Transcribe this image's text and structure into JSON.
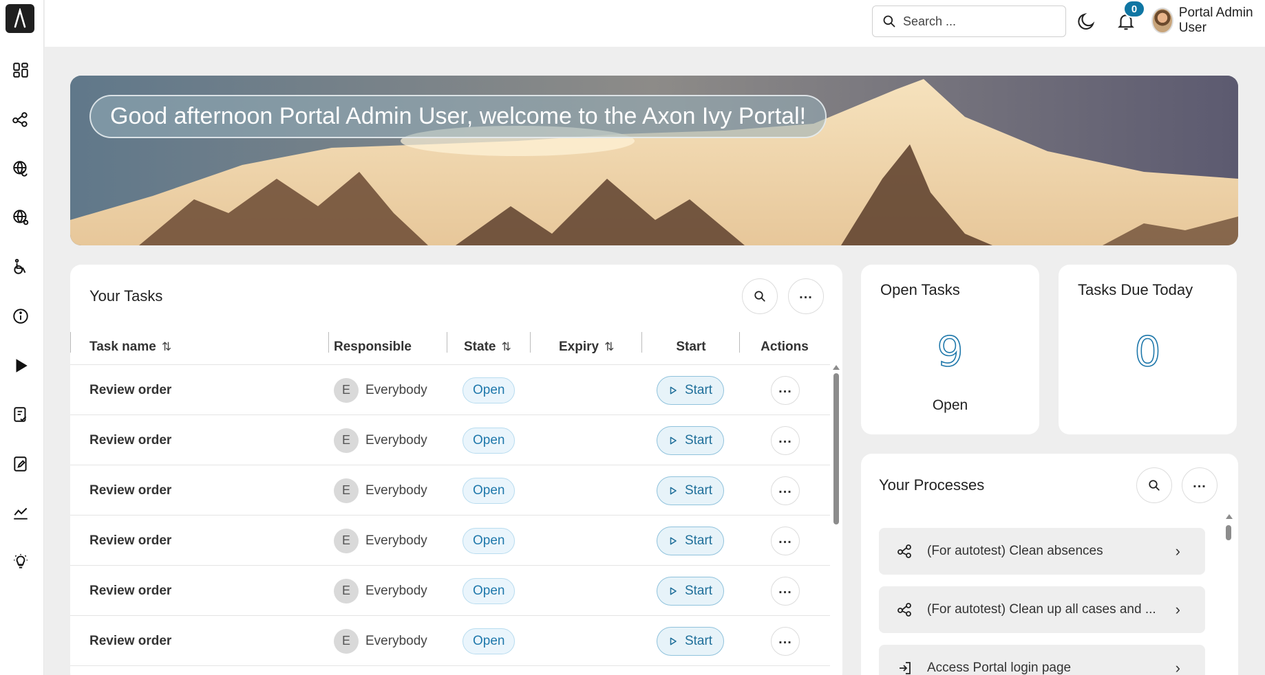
{
  "topbar": {
    "search_placeholder": "Search ...",
    "notification_count": "0",
    "user_name": "Portal Admin User"
  },
  "sidebar": {
    "items": [
      {
        "icon": "dashboard-icon"
      },
      {
        "icon": "process-icon"
      },
      {
        "icon": "globe-refresh-icon"
      },
      {
        "icon": "globe-network-icon"
      },
      {
        "icon": "wheelchair-icon"
      },
      {
        "icon": "info-icon"
      },
      {
        "icon": "play-icon"
      },
      {
        "icon": "task-list-icon"
      },
      {
        "icon": "document-edit-icon"
      },
      {
        "icon": "statistics-icon"
      },
      {
        "icon": "lightbulb-icon"
      }
    ]
  },
  "banner": {
    "greeting": "Good afternoon Portal Admin User, welcome to the Axon Ivy Portal!"
  },
  "tasks": {
    "title": "Your Tasks",
    "columns": [
      "Task name",
      "Responsible",
      "State",
      "Expiry",
      "Start",
      "Actions"
    ],
    "rows": [
      {
        "name": "Review order",
        "responsible_initial": "E",
        "responsible": "Everybody",
        "state": "Open",
        "start": "Start"
      },
      {
        "name": "Review order",
        "responsible_initial": "E",
        "responsible": "Everybody",
        "state": "Open",
        "start": "Start"
      },
      {
        "name": "Review order",
        "responsible_initial": "E",
        "responsible": "Everybody",
        "state": "Open",
        "start": "Start"
      },
      {
        "name": "Review order",
        "responsible_initial": "E",
        "responsible": "Everybody",
        "state": "Open",
        "start": "Start"
      },
      {
        "name": "Review order",
        "responsible_initial": "E",
        "responsible": "Everybody",
        "state": "Open",
        "start": "Start"
      },
      {
        "name": "Review order",
        "responsible_initial": "E",
        "responsible": "Everybody",
        "state": "Open",
        "start": "Start"
      }
    ]
  },
  "open_tasks": {
    "title": "Open Tasks",
    "count": "9",
    "label": "Open"
  },
  "tasks_due_today": {
    "title": "Tasks Due Today",
    "count": "0"
  },
  "processes": {
    "title": "Your Processes",
    "items": [
      {
        "icon": "process-icon",
        "label": "(For autotest) Clean absences"
      },
      {
        "icon": "process-icon",
        "label": "(For autotest) Clean up all cases and ..."
      },
      {
        "icon": "login-icon",
        "label": "Access Portal login page"
      }
    ]
  },
  "colors": {
    "accent": "#1f78ab",
    "badge": "#0f76a3"
  }
}
